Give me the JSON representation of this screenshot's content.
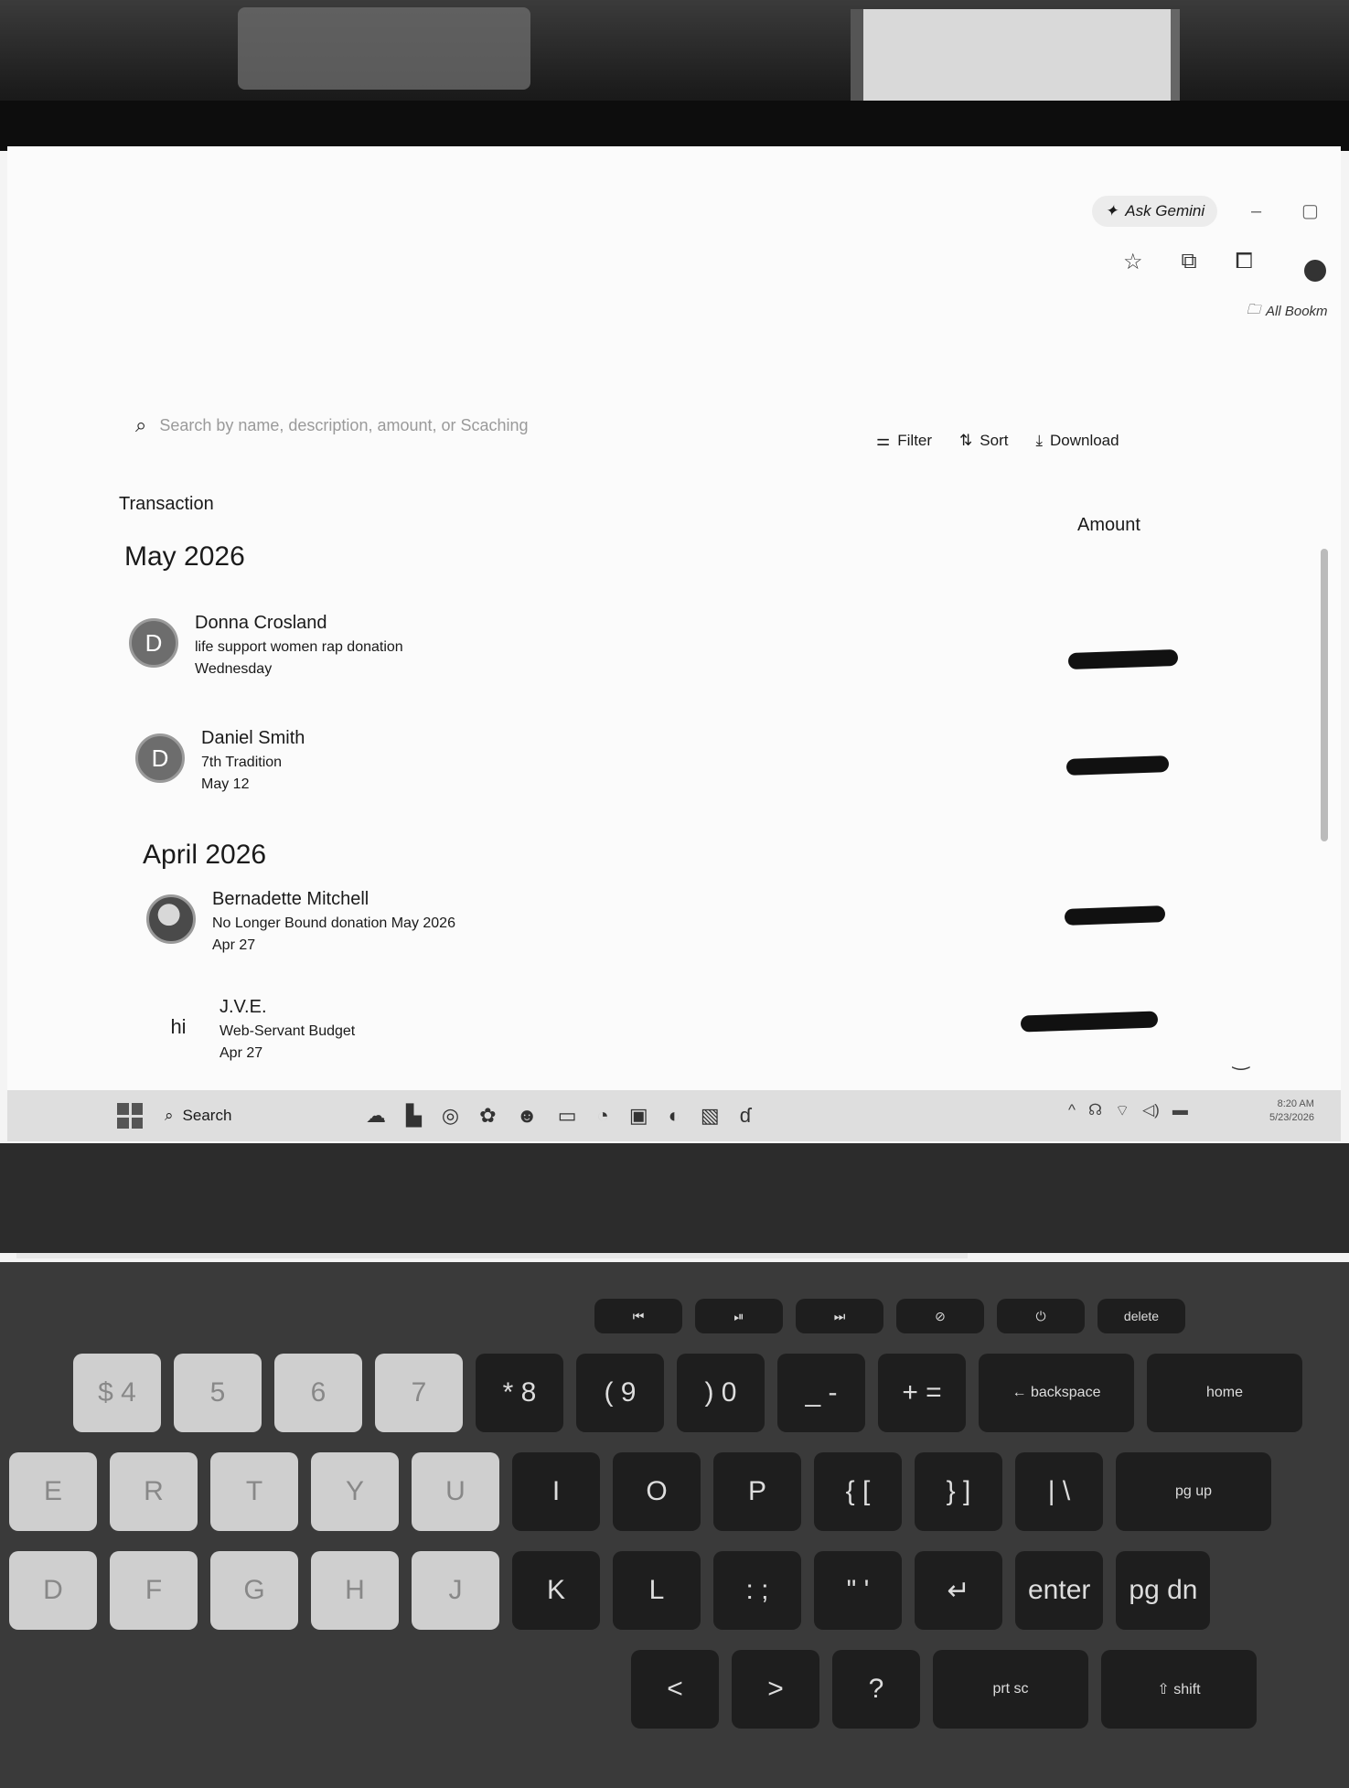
{
  "browser": {
    "gemini_label": "Ask Gemini",
    "bookmarks_label": "All Bookm"
  },
  "search": {
    "placeholder": "Search by name, description, amount, or Scaching"
  },
  "actions": {
    "filter": "Filter",
    "sort": "Sort",
    "download": "Download"
  },
  "table": {
    "col_transaction": "Transaction",
    "col_amount": "Amount"
  },
  "groups": [
    {
      "month": "May 2026",
      "items": [
        {
          "initial": "D",
          "name": "Donna Crosland",
          "description": "life support women rap donation",
          "date": "Wednesday"
        },
        {
          "initial": "D",
          "name": "Daniel Smith",
          "description": "7th Tradition",
          "date": "May 12"
        }
      ]
    },
    {
      "month": "April 2026",
      "items": [
        {
          "initial": "",
          "name": "Bernadette Mitchell",
          "description": "No Longer Bound donation May 2026",
          "date": "Apr 27"
        },
        {
          "initial": "hi",
          "name": "J.V.E.",
          "description": "Web-Servant Budget",
          "date": "Apr 27"
        }
      ]
    }
  ],
  "taskbar": {
    "search_label": "Search",
    "time": "8:20 AM",
    "date": "5/23/2026"
  },
  "keyboard": {
    "fn_row": [
      "⏮",
      "⏯",
      "⏭",
      "⊘",
      "⏻",
      "delete"
    ],
    "num_row": [
      "$ 4",
      "5",
      "6",
      "7",
      "* 8",
      "( 9",
      ") 0",
      "_ -",
      "+ =",
      "← backspace",
      "home"
    ],
    "top_row": [
      "E",
      "R",
      "T",
      "Y",
      "U",
      "I",
      "O",
      "P",
      "{ [",
      "} ]",
      "| \\",
      "pg up"
    ],
    "home_row": [
      "D",
      "F",
      "G",
      "H",
      "J",
      "K",
      "L",
      ": ;",
      "\" '",
      "↵",
      "enter",
      "pg dn"
    ],
    "bottom_row": [
      "<",
      ">",
      "?",
      "prt sc",
      "⇧ shift"
    ]
  }
}
